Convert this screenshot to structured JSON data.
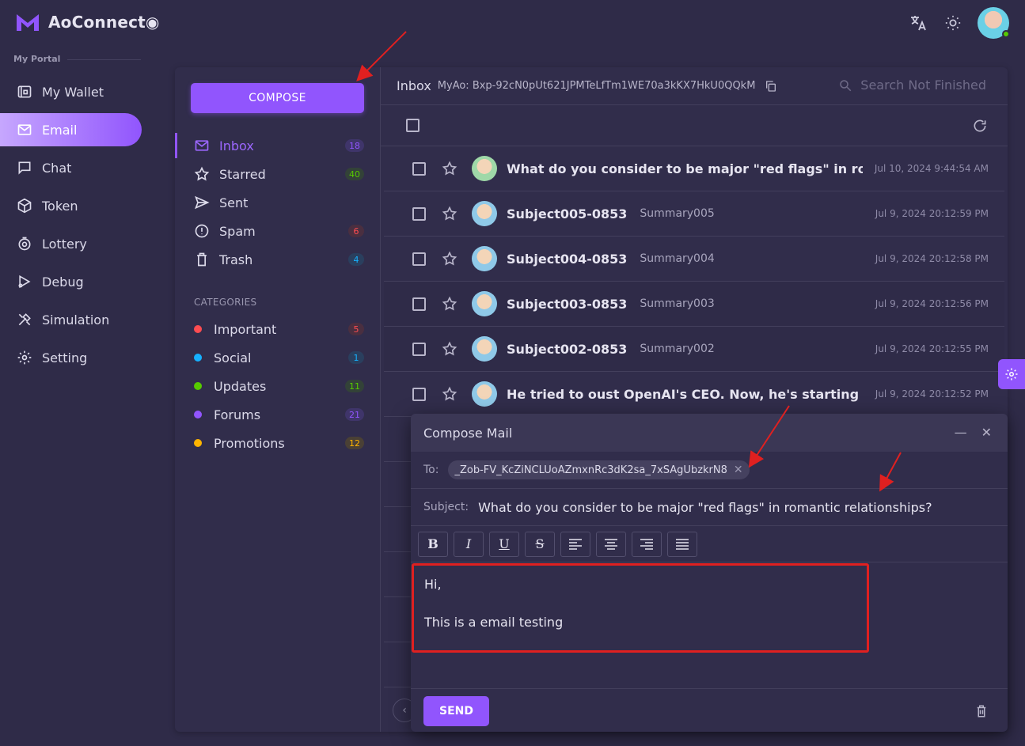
{
  "app": {
    "name": "AoConnect◉"
  },
  "sidebar": {
    "section_title": "My Portal",
    "items": [
      {
        "label": "My Wallet",
        "icon": "wallet-icon",
        "active": false
      },
      {
        "label": "Email",
        "icon": "mail-icon",
        "active": true
      },
      {
        "label": "Chat",
        "icon": "chat-icon",
        "active": false
      },
      {
        "label": "Token",
        "icon": "token-icon",
        "active": false
      },
      {
        "label": "Lottery",
        "icon": "lottery-icon",
        "active": false
      },
      {
        "label": "Debug",
        "icon": "debug-icon",
        "active": false
      },
      {
        "label": "Simulation",
        "icon": "simulation-icon",
        "active": false
      },
      {
        "label": "Setting",
        "icon": "gear-icon",
        "active": false
      }
    ]
  },
  "email": {
    "compose_label": "COMPOSE",
    "folders": [
      {
        "label": "Inbox",
        "count": "18",
        "color": "#9155fd",
        "bg": "#3f356a"
      },
      {
        "label": "Starred",
        "count": "40",
        "color": "#56ca00",
        "bg": "#334238"
      },
      {
        "label": "Sent",
        "count": "",
        "color": "",
        "bg": ""
      },
      {
        "label": "Spam",
        "count": "6",
        "color": "#ff4c51",
        "bg": "#4a2f40"
      },
      {
        "label": "Trash",
        "count": "4",
        "color": "#16b1ff",
        "bg": "#2a3f5e"
      }
    ],
    "categories_title": "CATEGORIES",
    "categories": [
      {
        "label": "Important",
        "count": "5",
        "color": "#ff4c51",
        "bg": "#4a2f40"
      },
      {
        "label": "Social",
        "count": "1",
        "color": "#16b1ff",
        "bg": "#2a3f5e"
      },
      {
        "label": "Updates",
        "count": "11",
        "color": "#56ca00",
        "bg": "#334238"
      },
      {
        "label": "Forums",
        "count": "21",
        "color": "#9155fd",
        "bg": "#3f356a"
      },
      {
        "label": "Promotions",
        "count": "12",
        "color": "#ffb400",
        "bg": "#4a4035"
      }
    ],
    "header": {
      "title": "Inbox",
      "address": "MyAo: Bxp-92cN0pUt621JPMTeLfTm1WE70a3kKX7HkU0QQkM",
      "search_placeholder": "Search Not Finished"
    },
    "mails": [
      {
        "subject": "What do you consider to be major \"red flags\" in romantic r",
        "summary": "",
        "date": "Jul 10, 2024 9:44:54 AM",
        "avatar": "green"
      },
      {
        "subject": "Subject005-0853",
        "summary": "Summary005",
        "date": "Jul 9, 2024 20:12:59 PM",
        "avatar": "blue"
      },
      {
        "subject": "Subject004-0853",
        "summary": "Summary004",
        "date": "Jul 9, 2024 20:12:58 PM",
        "avatar": "blue"
      },
      {
        "subject": "Subject003-0853",
        "summary": "Summary003",
        "date": "Jul 9, 2024 20:12:56 PM",
        "avatar": "blue"
      },
      {
        "subject": "Subject002-0853",
        "summary": "Summary002",
        "date": "Jul 9, 2024 20:12:55 PM",
        "avatar": "blue"
      },
      {
        "subject": "He tried to oust OpenAI's CEO. Now, he's starting a 'safe' ri",
        "summary": "",
        "date": "Jul 9, 2024 20:12:52 PM",
        "avatar": "blue"
      }
    ]
  },
  "compose": {
    "title": "Compose Mail",
    "to_label": "To:",
    "to_value": "_Zob-FV_KcZiNCLUoAZmxnRc3dK2sa_7xSAgUbzkrN8",
    "subject_label": "Subject:",
    "subject_value": "What do you consider to be major \"red flags\" in romantic relationships?",
    "toolbar": [
      "B",
      "I",
      "U",
      "S",
      "align-left",
      "align-center",
      "align-right",
      "align-justify"
    ],
    "body_line1": "Hi,",
    "body_line2": "This is a email testing",
    "send_label": "SEND"
  },
  "colors": {
    "accent": "#9155fd",
    "highlight": "#e02020"
  }
}
